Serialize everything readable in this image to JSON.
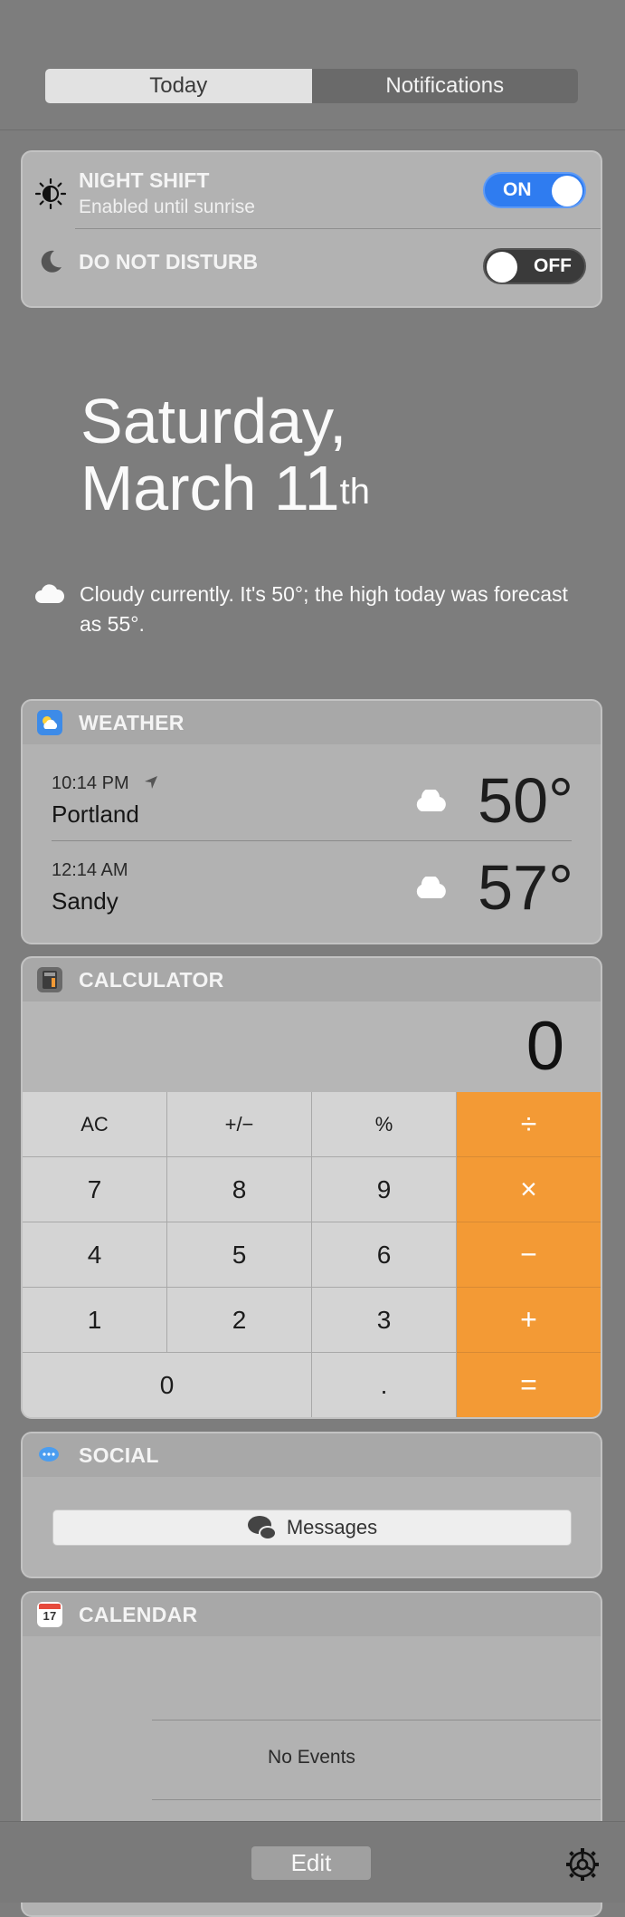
{
  "tabs": {
    "today": "Today",
    "notifications": "Notifications"
  },
  "night_shift": {
    "title": "NIGHT SHIFT",
    "subtitle": "Enabled until sunrise",
    "state": "ON"
  },
  "do_not_disturb": {
    "title": "DO NOT DISTURB",
    "state": "OFF"
  },
  "date": {
    "line1": "Saturday,",
    "line2": "March 11",
    "suffix": "th"
  },
  "summary": "Cloudy currently. It's 50°; the high today was forecast as 55°.",
  "weather": {
    "title": "WEATHER",
    "locations": [
      {
        "time": "10:14 PM",
        "city": "Portland",
        "temp": "50°",
        "condition": "cloud-icon",
        "current": true
      },
      {
        "time": "12:14 AM",
        "city": "Sandy",
        "temp": "57°",
        "condition": "cloud-icon",
        "current": false
      }
    ]
  },
  "calculator": {
    "title": "CALCULATOR",
    "display": "0",
    "keys": {
      "ac": "AC",
      "sign": "+/−",
      "percent": "%",
      "divide": "÷",
      "seven": "7",
      "eight": "8",
      "nine": "9",
      "multiply": "×",
      "four": "4",
      "five": "5",
      "six": "6",
      "minus": "−",
      "one": "1",
      "two": "2",
      "three": "3",
      "plus": "+",
      "zero": "0",
      "decimal": ".",
      "equals": "="
    },
    "accent": "#f39a35"
  },
  "social": {
    "title": "SOCIAL",
    "button": "Messages"
  },
  "calendar": {
    "title": "CALENDAR",
    "icon_day": "17",
    "empty": "No Events"
  },
  "bottom": {
    "edit": "Edit"
  }
}
